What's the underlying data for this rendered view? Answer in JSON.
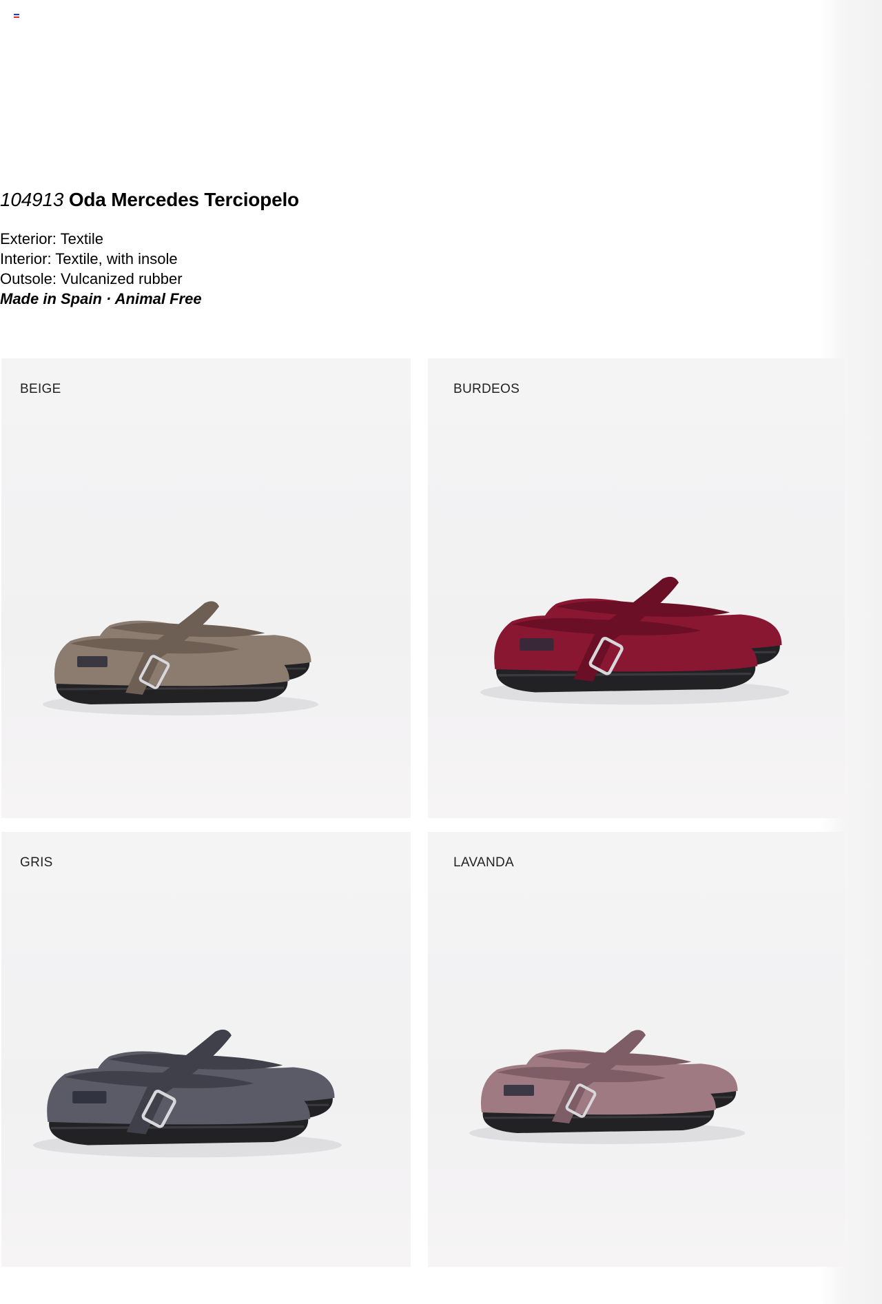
{
  "header": {
    "language_flag_icon": "flag-icon",
    "flag_colors": [
      "#2b3f9e",
      "#e7e7ef",
      "#d23a3a"
    ]
  },
  "product": {
    "reference": "104913",
    "name": "Oda Mercedes Terciopelo",
    "specs": [
      "Exterior: Textile",
      "Interior: Textile, with insole",
      "Outsole: Vulcanized rubber"
    ],
    "origin_note": "Made in Spain · Animal Free"
  },
  "variants": [
    {
      "label": "BEIGE",
      "upper_color": "#8c7b6f",
      "shade_color": "#6e5f55",
      "brand_tag": "victoria"
    },
    {
      "label": "BURDEOS",
      "upper_color": "#8a1732",
      "shade_color": "#6b0f26",
      "brand_tag": "victoria"
    },
    {
      "label": "GRIS",
      "upper_color": "#5a5b66",
      "shade_color": "#3f404a",
      "brand_tag": "victoria"
    },
    {
      "label": "LAVANDA",
      "upper_color": "#a07a82",
      "shade_color": "#7e5d66",
      "brand_tag": "victoria"
    }
  ]
}
